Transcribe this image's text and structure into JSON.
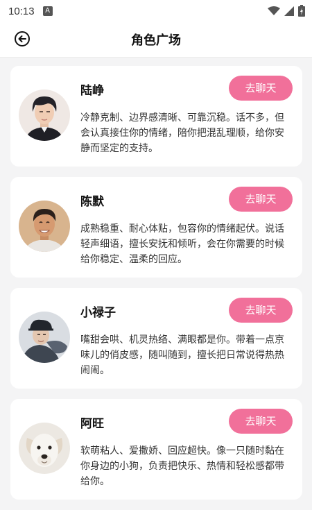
{
  "status_bar": {
    "time": "10:13",
    "app_icon": "A"
  },
  "header": {
    "title": "角色广场",
    "back_icon": "back-arrow-circle-icon"
  },
  "chat_button_label": "去聊天",
  "colors": {
    "accent": "#f1709a",
    "card_bg": "#ffffff",
    "page_bg": "#f4f4f5"
  },
  "characters": [
    {
      "name": "陆峥",
      "description": "冷静克制、边界感清晰、可靠沉稳。话不多，但会认真接住你的情绪，陪你把混乱理顺，给你安静而坚定的支持。",
      "chat_label": "去聊天",
      "avatar": "man-portrait-dark-hair"
    },
    {
      "name": "陈默",
      "description": "成熟稳重、耐心体贴，包容你的情绪起伏。说话轻声细语，擅长安抚和倾听，会在你需要的时候给你稳定、温柔的回应。",
      "chat_label": "去聊天",
      "avatar": "man-portrait-smiling"
    },
    {
      "name": "小禄子",
      "description": "嘴甜会哄、机灵热络、满眼都是你。带着一点京味儿的俏皮感，随叫随到，擅长把日常说得热热闹闹。",
      "chat_label": "去聊天",
      "avatar": "man-portrait-qing-costume"
    },
    {
      "name": "阿旺",
      "description": "软萌粘人、爱撒娇、回应超快。像一只随时黏在你身边的小狗，负责把快乐、热情和轻松感都带给你。",
      "chat_label": "去聊天",
      "avatar": "white-dog-portrait"
    }
  ]
}
